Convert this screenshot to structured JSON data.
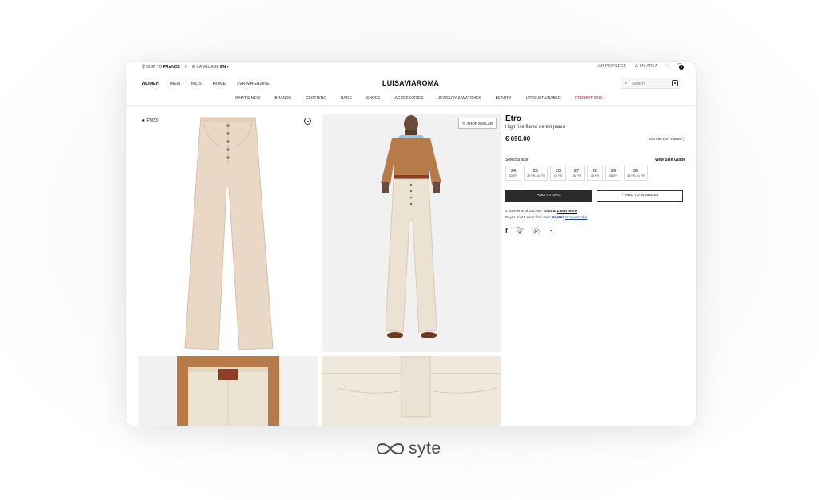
{
  "utility": {
    "ship_to_label": "SHIP TO",
    "ship_to_country": "FRANCE",
    "currency": "€",
    "language_label": "LANGUAGE",
    "language_value": "EN",
    "privilege": "LVR PRIVILEGE",
    "my_area": "MY AREA",
    "bag_count": "0"
  },
  "header": {
    "nav": [
      "WOMEN",
      "MEN",
      "KIDS",
      "HOME",
      "LVR MAGAZINE"
    ],
    "logo": "LUISAVIAROMA",
    "search_placeholder": "Search"
  },
  "categories": [
    "WHAT'S NEW",
    "BRANDS",
    "CLOTHING",
    "BAGS",
    "SHOES",
    "ACCESSORIES",
    "JEWELRY & WATCHES",
    "BEAUTY",
    "LVRSUSTAINABLE",
    "PROMOTIONS"
  ],
  "gallery": {
    "badge": "FW23",
    "shop_similar": "SHOP SIMILAR"
  },
  "product": {
    "brand": "Etro",
    "name": "High rise flared denim jeans",
    "price": "€ 690.00",
    "points": "Get 690 LVR Points",
    "select_size": "Select a size",
    "size_guide": "View Size Guide",
    "sizes": [
      {
        "s": "24",
        "f": "32 FR"
      },
      {
        "s": "25",
        "f": "32 FR-34 FR"
      },
      {
        "s": "26",
        "f": "34 FR"
      },
      {
        "s": "27",
        "f": "36 FR"
      },
      {
        "s": "28",
        "f": "36 FR"
      },
      {
        "s": "29",
        "f": "38 FR"
      },
      {
        "s": "30",
        "f": "38 FR-40 FR"
      }
    ],
    "add_to_bag": "ADD TO BAG",
    "add_to_wishlist": "ADD TO WISHLIST",
    "klarna_text": "3 payments of 230,00€.",
    "klarna_brand": "Klarna.",
    "learn_more": "Learn more",
    "paypal_text": "Payez en 4X sans frais avec",
    "paypal_brand": "PayPal",
    "paypal_link": "En savoir plus"
  },
  "footer_brand": "syte",
  "colors": {
    "accent_promo": "#d0021b",
    "button_dark": "#2b2b2b",
    "denim": "#ead8c6",
    "sweater": "#b77b4a"
  }
}
